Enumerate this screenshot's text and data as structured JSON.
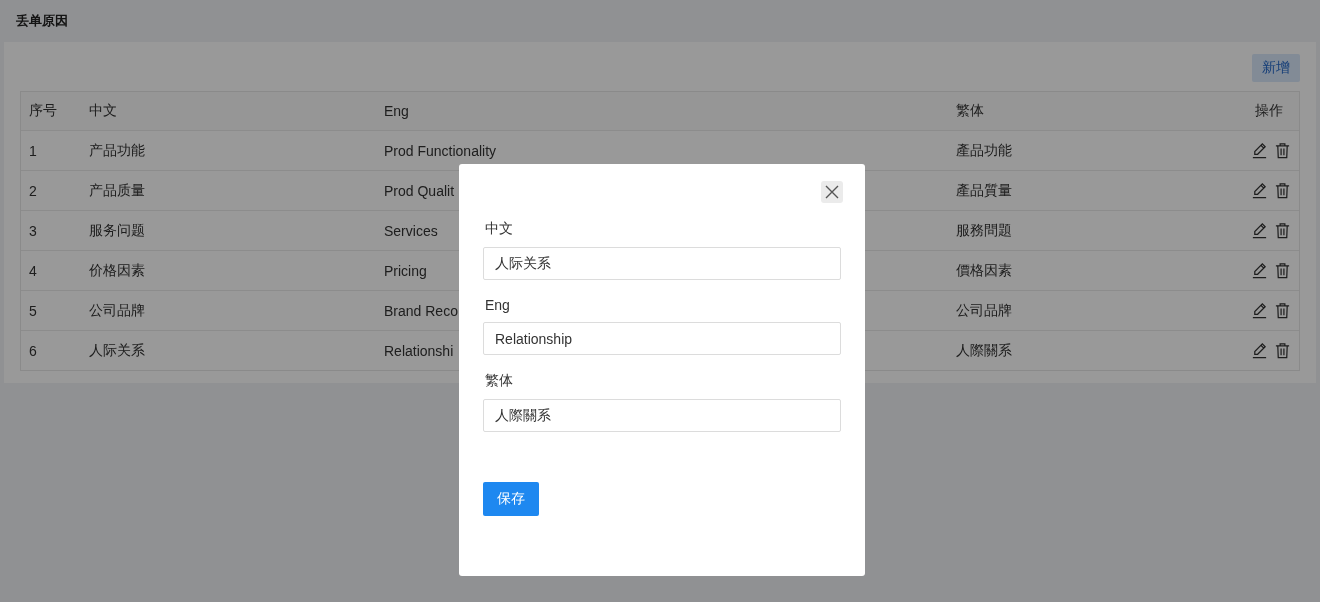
{
  "page": {
    "title": "丢单原因",
    "add_button": "新增"
  },
  "table": {
    "columns": [
      "序号",
      "中文",
      "Eng",
      "繁体",
      "操作"
    ],
    "rows": [
      {
        "index": "1",
        "zh": "产品功能",
        "eng": "Prod Functionality",
        "zh_hant": "產品功能"
      },
      {
        "index": "2",
        "zh": "产品质量",
        "eng": "Prod Qualit",
        "zh_hant": "產品質量"
      },
      {
        "index": "3",
        "zh": "服务问题",
        "eng": "Services",
        "zh_hant": "服務問題"
      },
      {
        "index": "4",
        "zh": "价格因素",
        "eng": "Pricing",
        "zh_hant": "價格因素"
      },
      {
        "index": "5",
        "zh": "公司品牌",
        "eng": "Brand Reco",
        "zh_hant": "公司品牌"
      },
      {
        "index": "6",
        "zh": "人际关系",
        "eng": "Relationshi",
        "zh_hant": "人際關系"
      }
    ]
  },
  "dialog": {
    "fields": [
      {
        "label": "中文",
        "value": "人际关系"
      },
      {
        "label": "Eng",
        "value": "Relationship"
      },
      {
        "label": "繁体",
        "value": "人際關系"
      }
    ],
    "save_button": "保存"
  }
}
